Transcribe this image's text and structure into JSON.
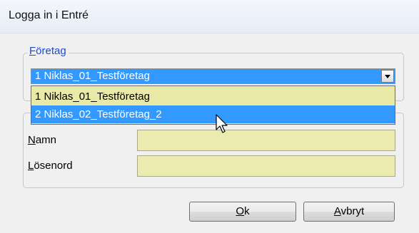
{
  "window": {
    "title": "Logga in i Entré"
  },
  "company_group": {
    "legend_first": "F",
    "legend_rest": "öretag",
    "selected": "1  Niklas_01_Testföretag",
    "options": [
      {
        "label": "1  Niklas_01_Testföretag"
      },
      {
        "label": "2  Niklas_02_Testföretag_2"
      }
    ]
  },
  "login_group": {
    "name_first": "N",
    "name_rest": "amn",
    "name_value": "",
    "password_first": "L",
    "password_rest": "ösenord",
    "password_value": ""
  },
  "buttons": {
    "ok_first": "O",
    "ok_rest": "k",
    "cancel_first": "A",
    "cancel_rest": "vbryt"
  },
  "colors": {
    "selection": "#3399ff",
    "input_background": "#ecebaf",
    "group_legend": "#1e49d6"
  },
  "icons": {
    "dropdown": "chevron-down-icon",
    "cursor": "mouse-pointer-icon"
  }
}
